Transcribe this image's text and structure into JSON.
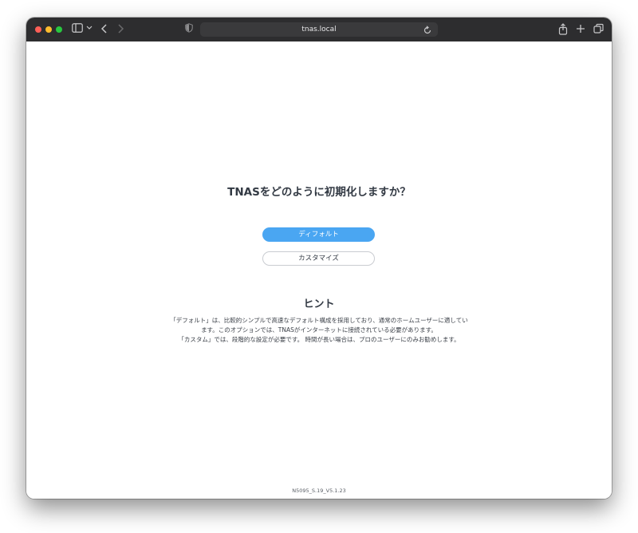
{
  "browser": {
    "url": "tnas.local",
    "icons": {
      "sidebar": "sidebar-icon",
      "back": "chevron-left-icon",
      "forward": "chevron-right-icon",
      "shield": "shield-icon",
      "reload": "reload-icon",
      "share": "share-icon",
      "new_tab": "plus-icon",
      "tabs": "tabs-overview-icon"
    }
  },
  "page": {
    "title": "TNASをどのように初期化しますか？",
    "buttons": {
      "default_label": "ディフォルト",
      "custom_label": "カスタマイズ"
    },
    "hint": {
      "title": "ヒント",
      "lines": [
        "「デフォルト」は、比較的シンプルで高速なデフォルト構成を採用しており、通常のホームユーザーに適してい",
        "ます。このオプションでは、TNASがインターネットに接続されている必要があります。",
        "「カスタム」では、段階的な設定が必要です。 時間が長い場合は、プロのユーザーにのみお勧めします。"
      ]
    },
    "footer": "N5095_S.19_V5.1.23"
  },
  "colors": {
    "primary": "#4aa6f2",
    "title_text": "#333a44",
    "titlebar": "#2d2d2f"
  }
}
